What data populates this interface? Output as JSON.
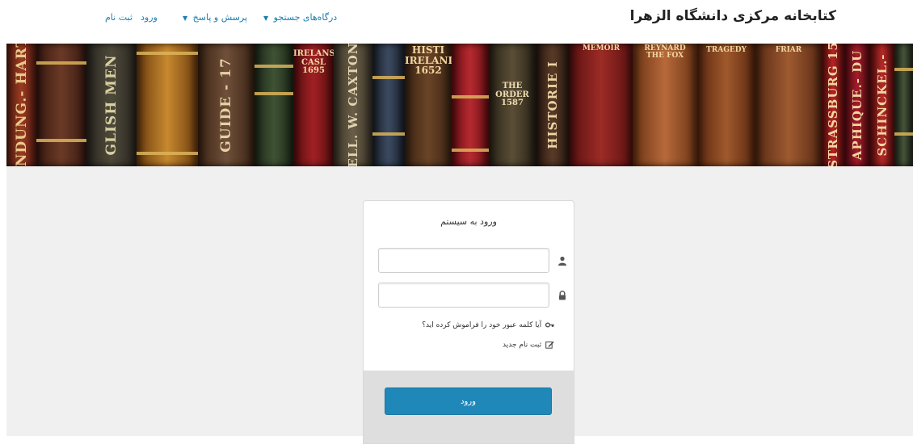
{
  "header": {
    "site_title": "کتابخانه مرکزی دانشگاه الزهرا",
    "nav": {
      "search_portals": "درگاه‌های جستجو",
      "qa": "پرسش و پاسخ",
      "login": "ورود",
      "register": "ثبت نام",
      "dropdown_caret": "▼"
    }
  },
  "banner": {
    "spines": [
      "INDUNG.- HART",
      "GLISH MEN",
      "GUIDE - 17",
      "ELL. W. CAXTON",
      "HISTORIE I",
      "STRASSBURG 15",
      "APHIQUE.- DU",
      "SCHINCKEL.-"
    ],
    "labels": {
      "histireland": "HISTI\nIRELANI\n1652",
      "irelans": "IRELANS\nCASL\n1695",
      "order": "THE\nORDER\n1587",
      "memoirs": "MEMOIR",
      "reynard": "REYNARD\nTHE FOX",
      "tragedy": "TRAGEDY",
      "friar": "FRIAR"
    }
  },
  "login": {
    "title": "ورود به سیستم",
    "username_value": "",
    "password_value": "",
    "forgot_password": "آیا کلمه عبور خود را فراموش کرده اید؟",
    "register_new": "ثبت نام جدید",
    "submit": "ورود"
  },
  "colors": {
    "link": "#1a7fb0",
    "button": "#1f88b8",
    "page_bg": "#f0f0f0",
    "footer_bg": "#dedede"
  },
  "icons": {
    "username": "user-icon",
    "password": "lock-icon",
    "forgot": "key-icon",
    "register": "edit-icon"
  }
}
